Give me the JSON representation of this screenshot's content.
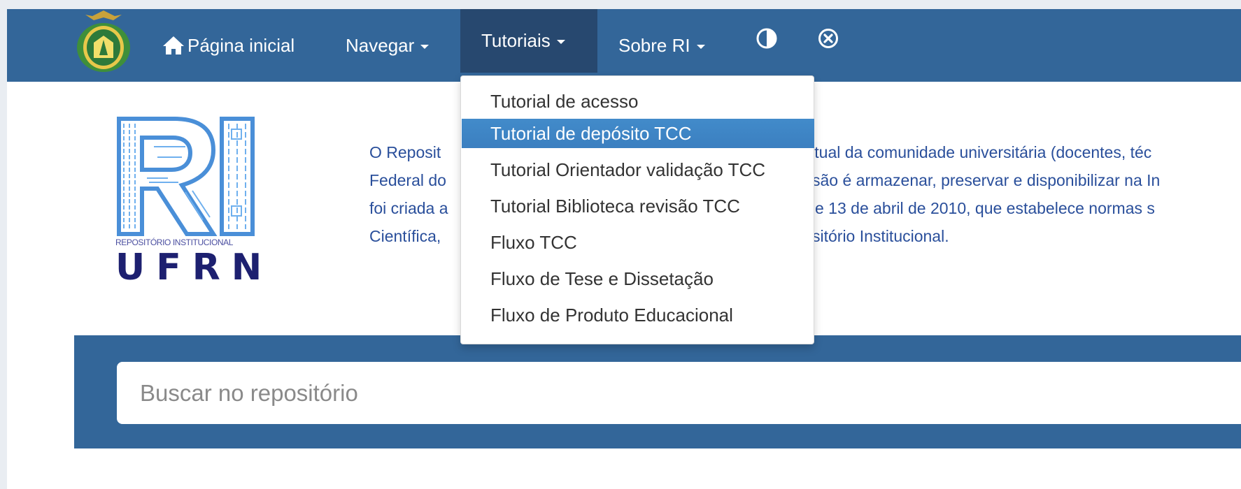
{
  "colors": {
    "navbar": "#336699",
    "active_tab": "#27486f",
    "intro_text": "#2a4f9b",
    "dropdown_highlight": "#428bca",
    "ufrn_logo": "#1d2070"
  },
  "nav": {
    "home_label": "Página inicial",
    "browse_label": "Navegar",
    "tutorials_label": "Tutoriais",
    "about_label": "Sobre RI",
    "contrast_icon": "contrast-icon",
    "close_icon": "close-circle-icon"
  },
  "logo": {
    "subtitle": "REPOSITÓRIO INSTITUCIONAL",
    "name": "UFRN"
  },
  "intro": {
    "lines": [
      {
        "left": "O Reposit",
        "right": "ectual da comunidade universitária (docentes, téc"
      },
      {
        "left": "Federal do",
        "right": "são é armazenar, preservar e disponibilizar na In"
      },
      {
        "left": "foi criada a",
        "right": "e 13 de abril de 2010, que estabelece normas s"
      },
      {
        "left": "Científica, ",
        "right": "sitório Institucional."
      }
    ]
  },
  "dropdown": {
    "items": [
      "Tutorial de acesso",
      "Tutorial de depósito TCC",
      "Tutorial Orientador validação TCC",
      "Tutorial Biblioteca revisão TCC",
      "Fluxo TCC",
      "Fluxo de Tese e Dissetação",
      "Fluxo de Produto Educacional"
    ],
    "highlighted_index": 1
  },
  "search": {
    "placeholder": "Buscar no repositório"
  }
}
